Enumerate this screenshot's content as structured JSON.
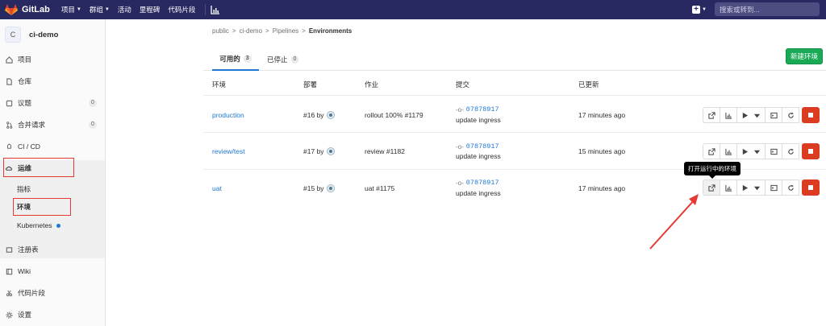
{
  "topbar": {
    "brand": "GitLab",
    "nav": [
      {
        "label": "项目",
        "caret": "▼"
      },
      {
        "label": "群组",
        "caret": "▼"
      },
      {
        "label": "活动"
      },
      {
        "label": "里程碑"
      },
      {
        "label": "代码片段"
      }
    ],
    "plus_caret": "▼",
    "search_placeholder": "搜索或转到..."
  },
  "sidebar": {
    "project_initial": "C",
    "project_name": "ci-demo",
    "items": [
      {
        "label": "项目",
        "icon": "home-icon"
      },
      {
        "label": "仓库",
        "icon": "file-icon"
      },
      {
        "label": "议题",
        "icon": "issues-icon",
        "badge": "0"
      },
      {
        "label": "合并请求",
        "icon": "merge-request-icon",
        "badge": "0"
      },
      {
        "label": "CI / CD",
        "icon": "rocket-icon"
      },
      {
        "label": "运维",
        "icon": "cloud-gear-icon"
      }
    ],
    "sub_items": [
      {
        "label": "指标"
      },
      {
        "label": "环境"
      },
      {
        "label": "Kubernetes"
      }
    ],
    "lower_items": [
      {
        "label": "注册表",
        "icon": "container-icon"
      },
      {
        "label": "Wiki",
        "icon": "book-icon"
      },
      {
        "label": "代码片段",
        "icon": "snippet-icon"
      },
      {
        "label": "设置",
        "icon": "gear-icon"
      }
    ]
  },
  "breadcrumb": {
    "items": [
      "public",
      "ci-demo",
      "Pipelines"
    ],
    "separator": ">",
    "current": "Environments"
  },
  "tabs": [
    {
      "label": "可用的",
      "count": "3"
    },
    {
      "label": "已停止",
      "count": "0"
    }
  ],
  "new_env_button": "新建环境",
  "table": {
    "headers": [
      "环境",
      "部署",
      "作业",
      "提交",
      "已更新"
    ],
    "rows": [
      {
        "env": "production",
        "deploy": "#16",
        "job": "rollout 100% #1179",
        "sha": "07878917",
        "message": "update ingress",
        "updated": "17 minutes ago"
      },
      {
        "env": "review/test",
        "deploy": "#17",
        "job": "review #1182",
        "sha": "07878917",
        "message": "update ingress",
        "updated": "15 minutes ago"
      },
      {
        "env": "uat",
        "deploy": "#15",
        "job": "uat #1175",
        "sha": "07878917",
        "message": "update ingress",
        "updated": "17 minutes ago"
      }
    ],
    "by": "by"
  },
  "tooltip": "打开运行中的环境",
  "colors": {
    "navbar": "#292961",
    "link": "#1f78d1",
    "success": "#1aaa55",
    "danger": "#db3b21",
    "annotation": "#e53a34"
  }
}
